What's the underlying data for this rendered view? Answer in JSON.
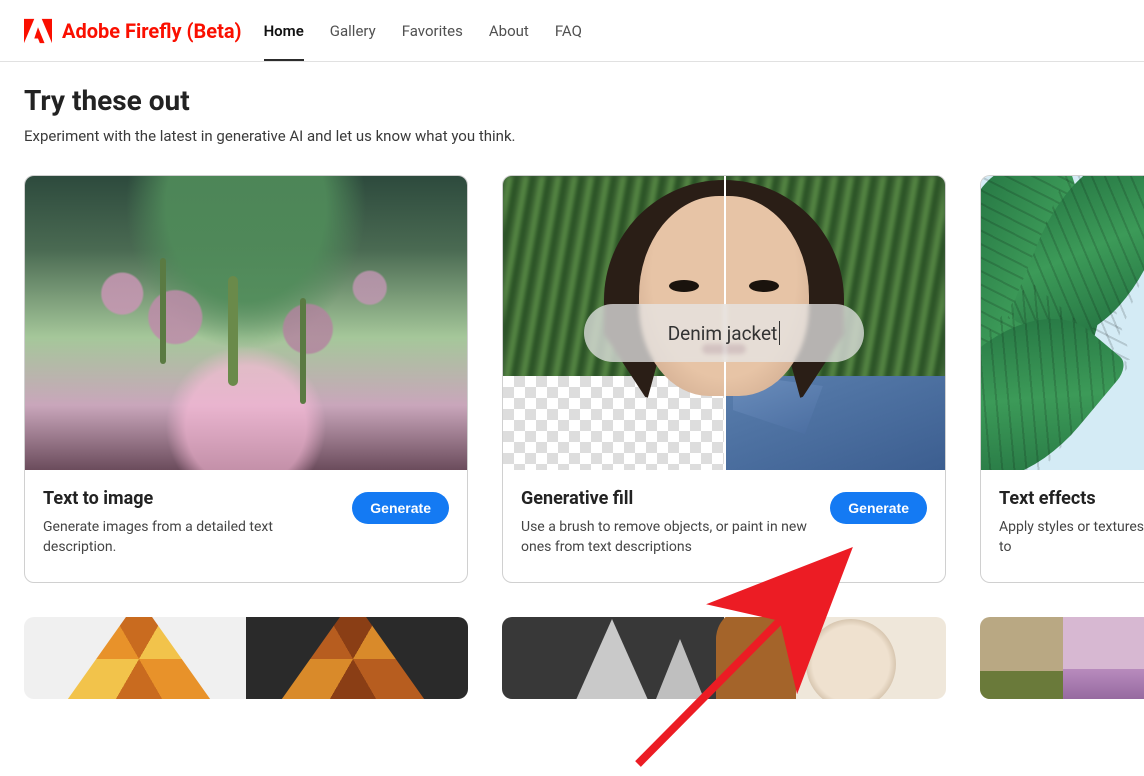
{
  "brand": "Adobe Firefly (Beta)",
  "nav": {
    "home": "Home",
    "gallery": "Gallery",
    "favorites": "Favorites",
    "about": "About",
    "faq": "FAQ"
  },
  "page": {
    "title": "Try these out",
    "subtitle": "Experiment with the latest in generative AI and let us know what you think."
  },
  "cards": {
    "text_to_image": {
      "title": "Text to image",
      "desc": "Generate images from a detailed text description.",
      "button": "Generate"
    },
    "generative_fill": {
      "title": "Generative fill",
      "desc": "Use a brush to remove objects, or paint in new ones from text descriptions",
      "button": "Generate",
      "prompt_text": "Denim jacket"
    },
    "text_effects": {
      "title": "Text effects",
      "desc": "Apply styles or textures to"
    }
  },
  "colors": {
    "brand": "#fa0f00",
    "primary_button": "#147af3"
  }
}
